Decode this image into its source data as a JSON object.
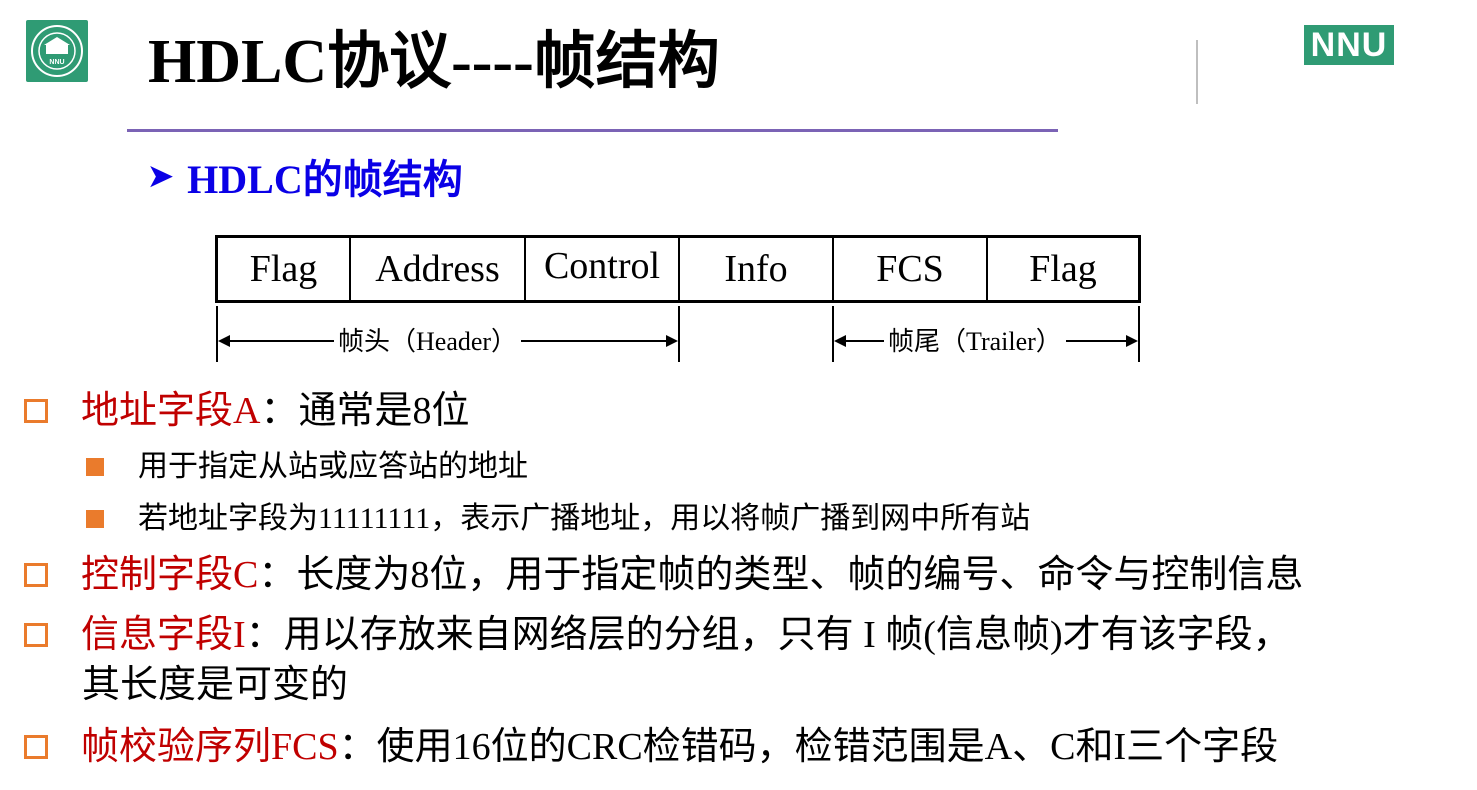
{
  "header": {
    "title": "HDLC协议----帧结构",
    "logo_right_text": "NNU",
    "logo_left_text": "NNU"
  },
  "subheading": {
    "marker": "➤",
    "text": "HDLC的帧结构"
  },
  "frame": {
    "fields": [
      "Flag",
      "Address",
      "Control",
      "Info",
      "FCS",
      "Flag"
    ],
    "header_span_label": "帧头（Header）",
    "trailer_span_label": "帧尾（Trailer）"
  },
  "bullets": [
    {
      "term": "地址字段A",
      "rest": "：通常是8位"
    },
    {
      "text": "用于指定从站或应答站的地址"
    },
    {
      "text": "若地址字段为11111111，表示广播地址，用以将帧广播到网中所有站"
    },
    {
      "term": "控制字段C",
      "rest": "：长度为8位，用于指定帧的类型、帧的编号、命令与控制信息"
    },
    {
      "term": "信息字段I",
      "rest": "：用以存放来自网络层的分组，只有 I 帧(信息帧)才有该字段，",
      "continuation": "其长度是可变的"
    },
    {
      "term": "帧校验序列FCS",
      "rest": "：使用16位的CRC检错码，检错范围是A、C和I三个字段"
    }
  ],
  "colors": {
    "brand_green": "#2f9b74",
    "title_rule": "#7b63b5",
    "subheading_blue": "#0a00e6",
    "term_red": "#c00000",
    "bullet_orange": "#ea7b2c"
  }
}
